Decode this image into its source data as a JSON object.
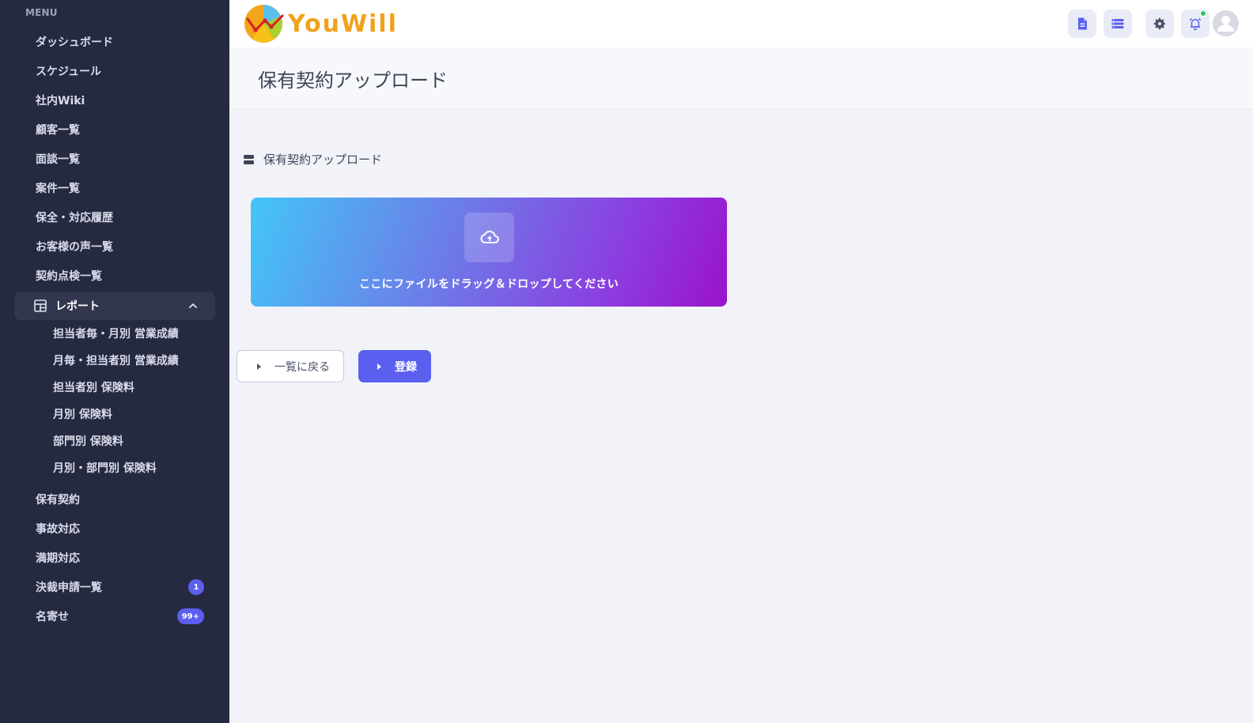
{
  "sidebar": {
    "menu_header": "MENU",
    "items": [
      {
        "label": "ダッシュボード"
      },
      {
        "label": "スケジュール"
      },
      {
        "label": "社内Wiki"
      },
      {
        "label": "顧客一覧"
      },
      {
        "label": "面談一覧"
      },
      {
        "label": "案件一覧"
      },
      {
        "label": "保全・対応履歴"
      },
      {
        "label": "お客様の声一覧"
      },
      {
        "label": "契約点検一覧"
      }
    ],
    "report_group": {
      "label": "レポート",
      "expanded": true,
      "subitems": [
        {
          "label": "担当者毎・月別 営業成績"
        },
        {
          "label": "月毎・担当者別 営業成績"
        },
        {
          "label": "担当者別 保険料"
        },
        {
          "label": "月別 保険料"
        },
        {
          "label": "部門別 保険料"
        },
        {
          "label": "月別・部門別 保険料"
        }
      ]
    },
    "items_after": [
      {
        "label": "保有契約"
      },
      {
        "label": "事故対応"
      },
      {
        "label": "満期対応"
      },
      {
        "label": "決裁申請一覧",
        "badge": "1"
      },
      {
        "label": "名寄せ",
        "badge": "99+"
      }
    ]
  },
  "header": {
    "logo_text": "YouWill",
    "icons": [
      "document-icon",
      "list-icon",
      "gear-icon",
      "bell-icon",
      "user-avatar-icon"
    ],
    "notification_status_color": "#2ec26a"
  },
  "page": {
    "title": "保有契約アップロード",
    "section_title": "保有契約アップロード",
    "dropzone_text": "ここにファイルをドラッグ＆ドロップしてください",
    "back_button": "一覧に戻る",
    "submit_button": "登録"
  },
  "colors": {
    "sidebar_bg": "#262a40",
    "accent": "#5b5ff0",
    "logo": "#f0a21a",
    "dropzone_gradient": [
      "#43c6f7",
      "#9b12cc"
    ]
  }
}
